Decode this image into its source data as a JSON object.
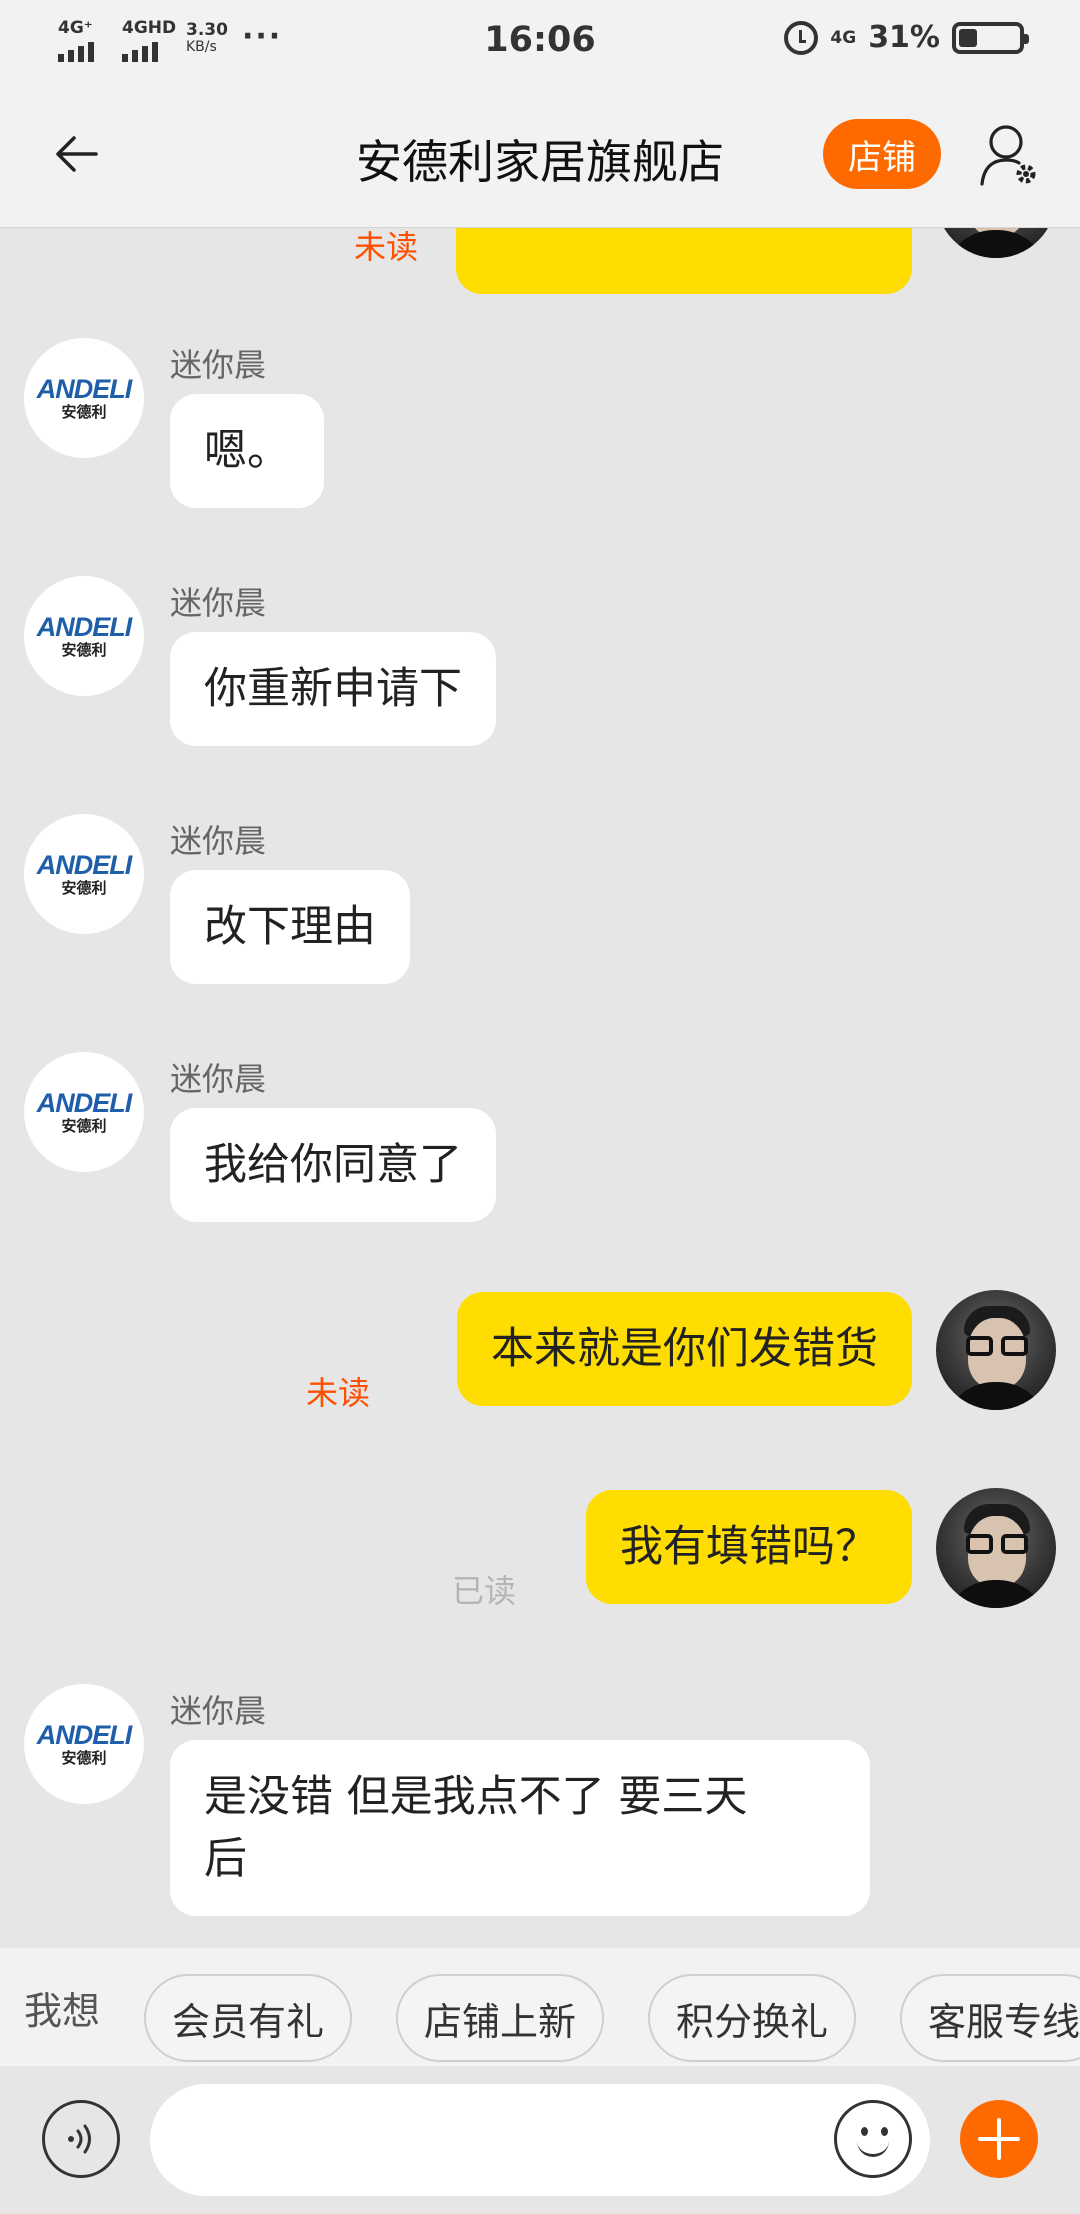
{
  "status_bar": {
    "net1": "4G⁺",
    "net2": "4GHD",
    "speed_value": "3.30",
    "speed_unit": "KB/s",
    "dots": "···",
    "time": "16:06",
    "net3": "4G",
    "battery": "31%",
    "battery_level": 0.31
  },
  "header": {
    "title": "安德利家居旗舰店",
    "shop_button": "店铺"
  },
  "shop_avatar": {
    "brand": "ANDELI",
    "brand_cn": "安德利"
  },
  "messages": [
    {
      "side": "out",
      "text": "",
      "status": "未读"
    },
    {
      "side": "in",
      "sender": "迷你晨",
      "text": "嗯。"
    },
    {
      "side": "in",
      "sender": "迷你晨",
      "text": "你重新申请下"
    },
    {
      "side": "in",
      "sender": "迷你晨",
      "text": "改下理由"
    },
    {
      "side": "in",
      "sender": "迷你晨",
      "text": "我给你同意了"
    },
    {
      "side": "out",
      "text": "本来就是你们发错货",
      "status": "未读"
    },
    {
      "side": "out",
      "text": "我有填错吗？",
      "status": "已读"
    },
    {
      "side": "in",
      "sender": "迷你晨",
      "text_line1": "是没错 但是我点不了 要三天",
      "text_line2": "后"
    }
  ],
  "quick_reply": {
    "label": "我想",
    "chips": [
      "会员有礼",
      "店铺上新",
      "积分换礼",
      "客服专线"
    ]
  },
  "input": {
    "placeholder": ""
  },
  "colors": {
    "accent": "#ff6a00",
    "my_bubble": "#ffdd00",
    "unread": "#ff5000",
    "read": "#b5b5b5",
    "background": "#e6e6e6"
  }
}
